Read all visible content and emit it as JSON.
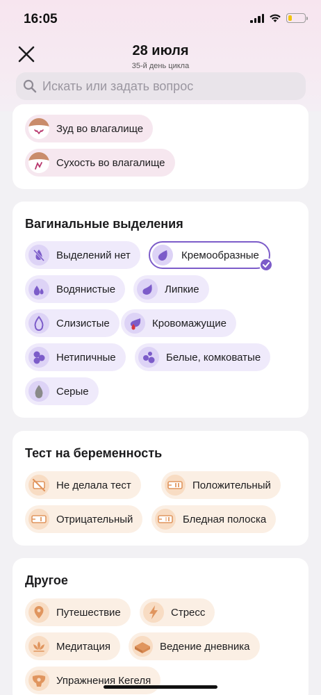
{
  "status_bar": {
    "time": "16:05"
  },
  "header": {
    "title": "28 июля",
    "subtitle": "35-й день цикла",
    "search_placeholder": "Искать или задать вопрос"
  },
  "colors": {
    "accent_purple": "#7c5cc9",
    "pink_chip": "#f6e7ef",
    "lavender_chip": "#efeafb",
    "peach_chip": "#fbefe4",
    "peach_icon": "#e0955e"
  },
  "symptoms_card": {
    "items": [
      {
        "label": "Зуд во влагалище",
        "icon": "itch-icon"
      },
      {
        "label": "Сухость во влагалище",
        "icon": "dryness-icon"
      }
    ]
  },
  "discharge_card": {
    "title": "Вагинальные выделения",
    "items": [
      {
        "label": "Выделений нет",
        "icon": "no-discharge-icon",
        "selected": false
      },
      {
        "label": "Кремообразные",
        "icon": "creamy-drop-icon",
        "selected": true
      },
      {
        "label": "Водянистые",
        "icon": "watery-drops-icon",
        "selected": false
      },
      {
        "label": "Липкие",
        "icon": "sticky-drop-icon",
        "selected": false
      },
      {
        "label": "Слизистые",
        "icon": "mucus-drop-icon",
        "selected": false
      },
      {
        "label": "Кровомажущие",
        "icon": "spotting-icon",
        "selected": false
      },
      {
        "label": "Нетипичные",
        "icon": "atypical-icon",
        "selected": false
      },
      {
        "label": "Белые, комковатые",
        "icon": "white-clumpy-icon",
        "selected": false
      },
      {
        "label": "Серые",
        "icon": "gray-drop-icon",
        "selected": false
      }
    ]
  },
  "pregnancy_card": {
    "title": "Тест на беременность",
    "items": [
      {
        "label": "Не делала тест",
        "icon": "no-test-icon"
      },
      {
        "label": "Положительный",
        "icon": "positive-test-icon"
      },
      {
        "label": "Отрицательный",
        "icon": "negative-test-icon"
      },
      {
        "label": "Бледная полоска",
        "icon": "faint-line-test-icon"
      }
    ]
  },
  "other_card": {
    "title": "Другое",
    "items": [
      {
        "label": "Путешествие",
        "icon": "location-pin-icon"
      },
      {
        "label": "Стресс",
        "icon": "lightning-icon"
      },
      {
        "label": "Медитация",
        "icon": "lotus-icon"
      },
      {
        "label": "Ведение дневника",
        "icon": "journal-icon"
      },
      {
        "label": "Упражнения Кегеля",
        "icon": "pelvis-icon"
      }
    ]
  }
}
